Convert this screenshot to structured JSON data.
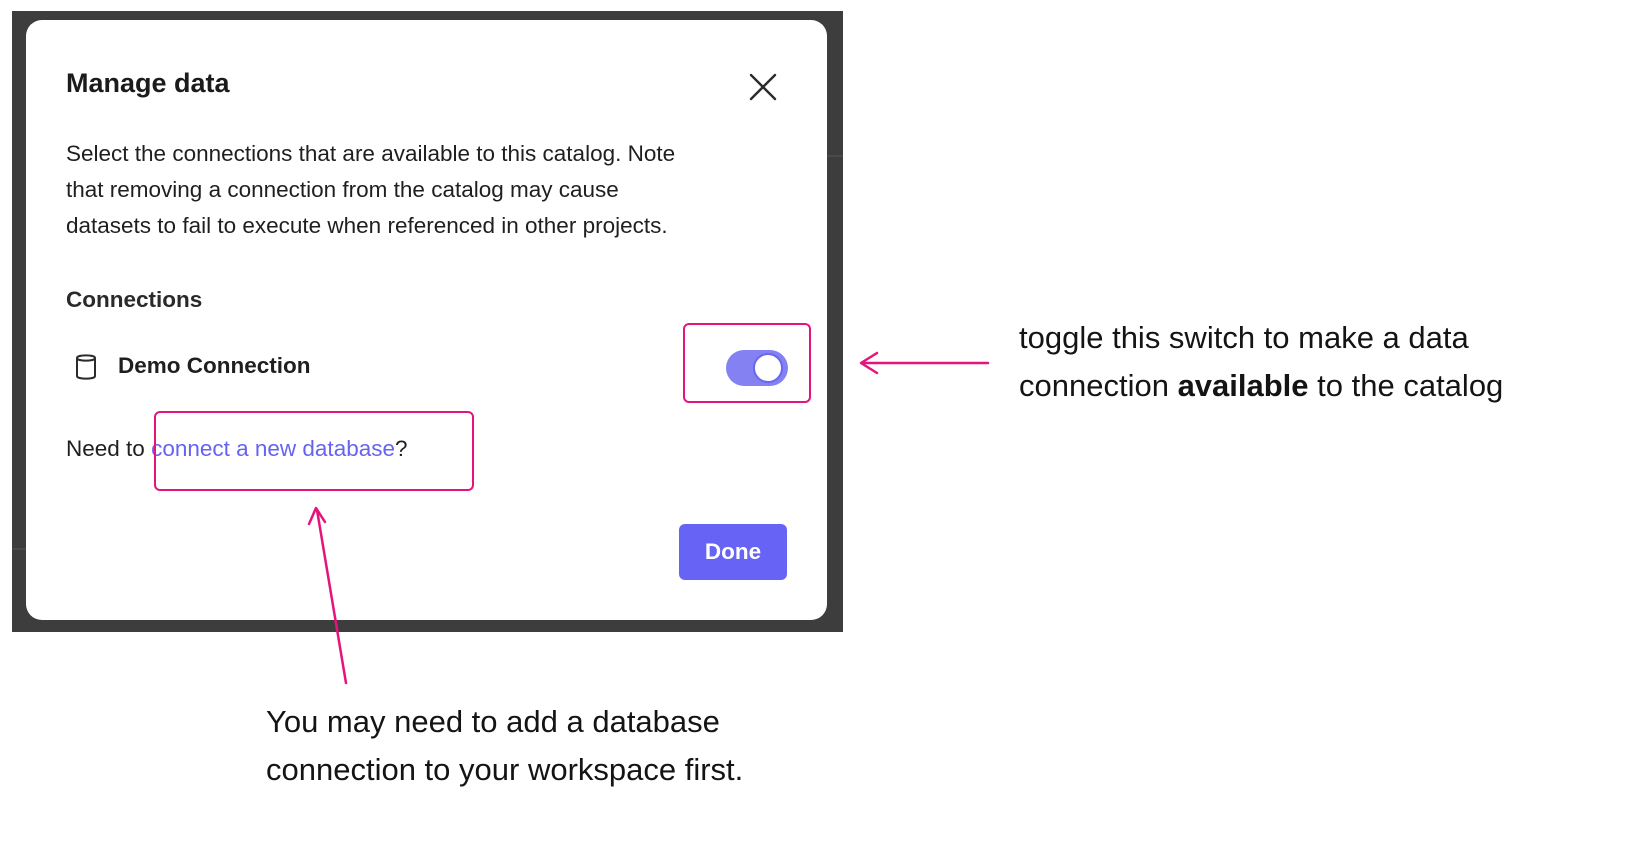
{
  "dialog": {
    "title": "Manage data",
    "close_icon": "close-icon",
    "description_lines": [
      "Select the connections that are available to this catalog. Note",
      "that removing a connection from the catalog may cause",
      "datasets to fail to execute when referenced in other projects."
    ],
    "connections_heading": "Connections",
    "connections": [
      {
        "icon": "database-icon",
        "name": "Demo Connection",
        "enabled": true
      }
    ],
    "helper": {
      "prefix": "Need to ",
      "link_text": "connect a new database",
      "suffix": "?"
    },
    "done_label": "Done"
  },
  "annotations": {
    "toggle_note": {
      "line1": "toggle this switch to make a data",
      "line2_prefix": "connection ",
      "line2_bold": "available",
      "line2_suffix": " to the catalog"
    },
    "link_note": {
      "line1": "You may need to add a database",
      "line2": "connection to your workspace first."
    }
  },
  "colors": {
    "accent": "#6663f5",
    "toggle_track": "#8482f3",
    "annotation": "#e5147c",
    "backdrop": "#3d3d3d"
  }
}
